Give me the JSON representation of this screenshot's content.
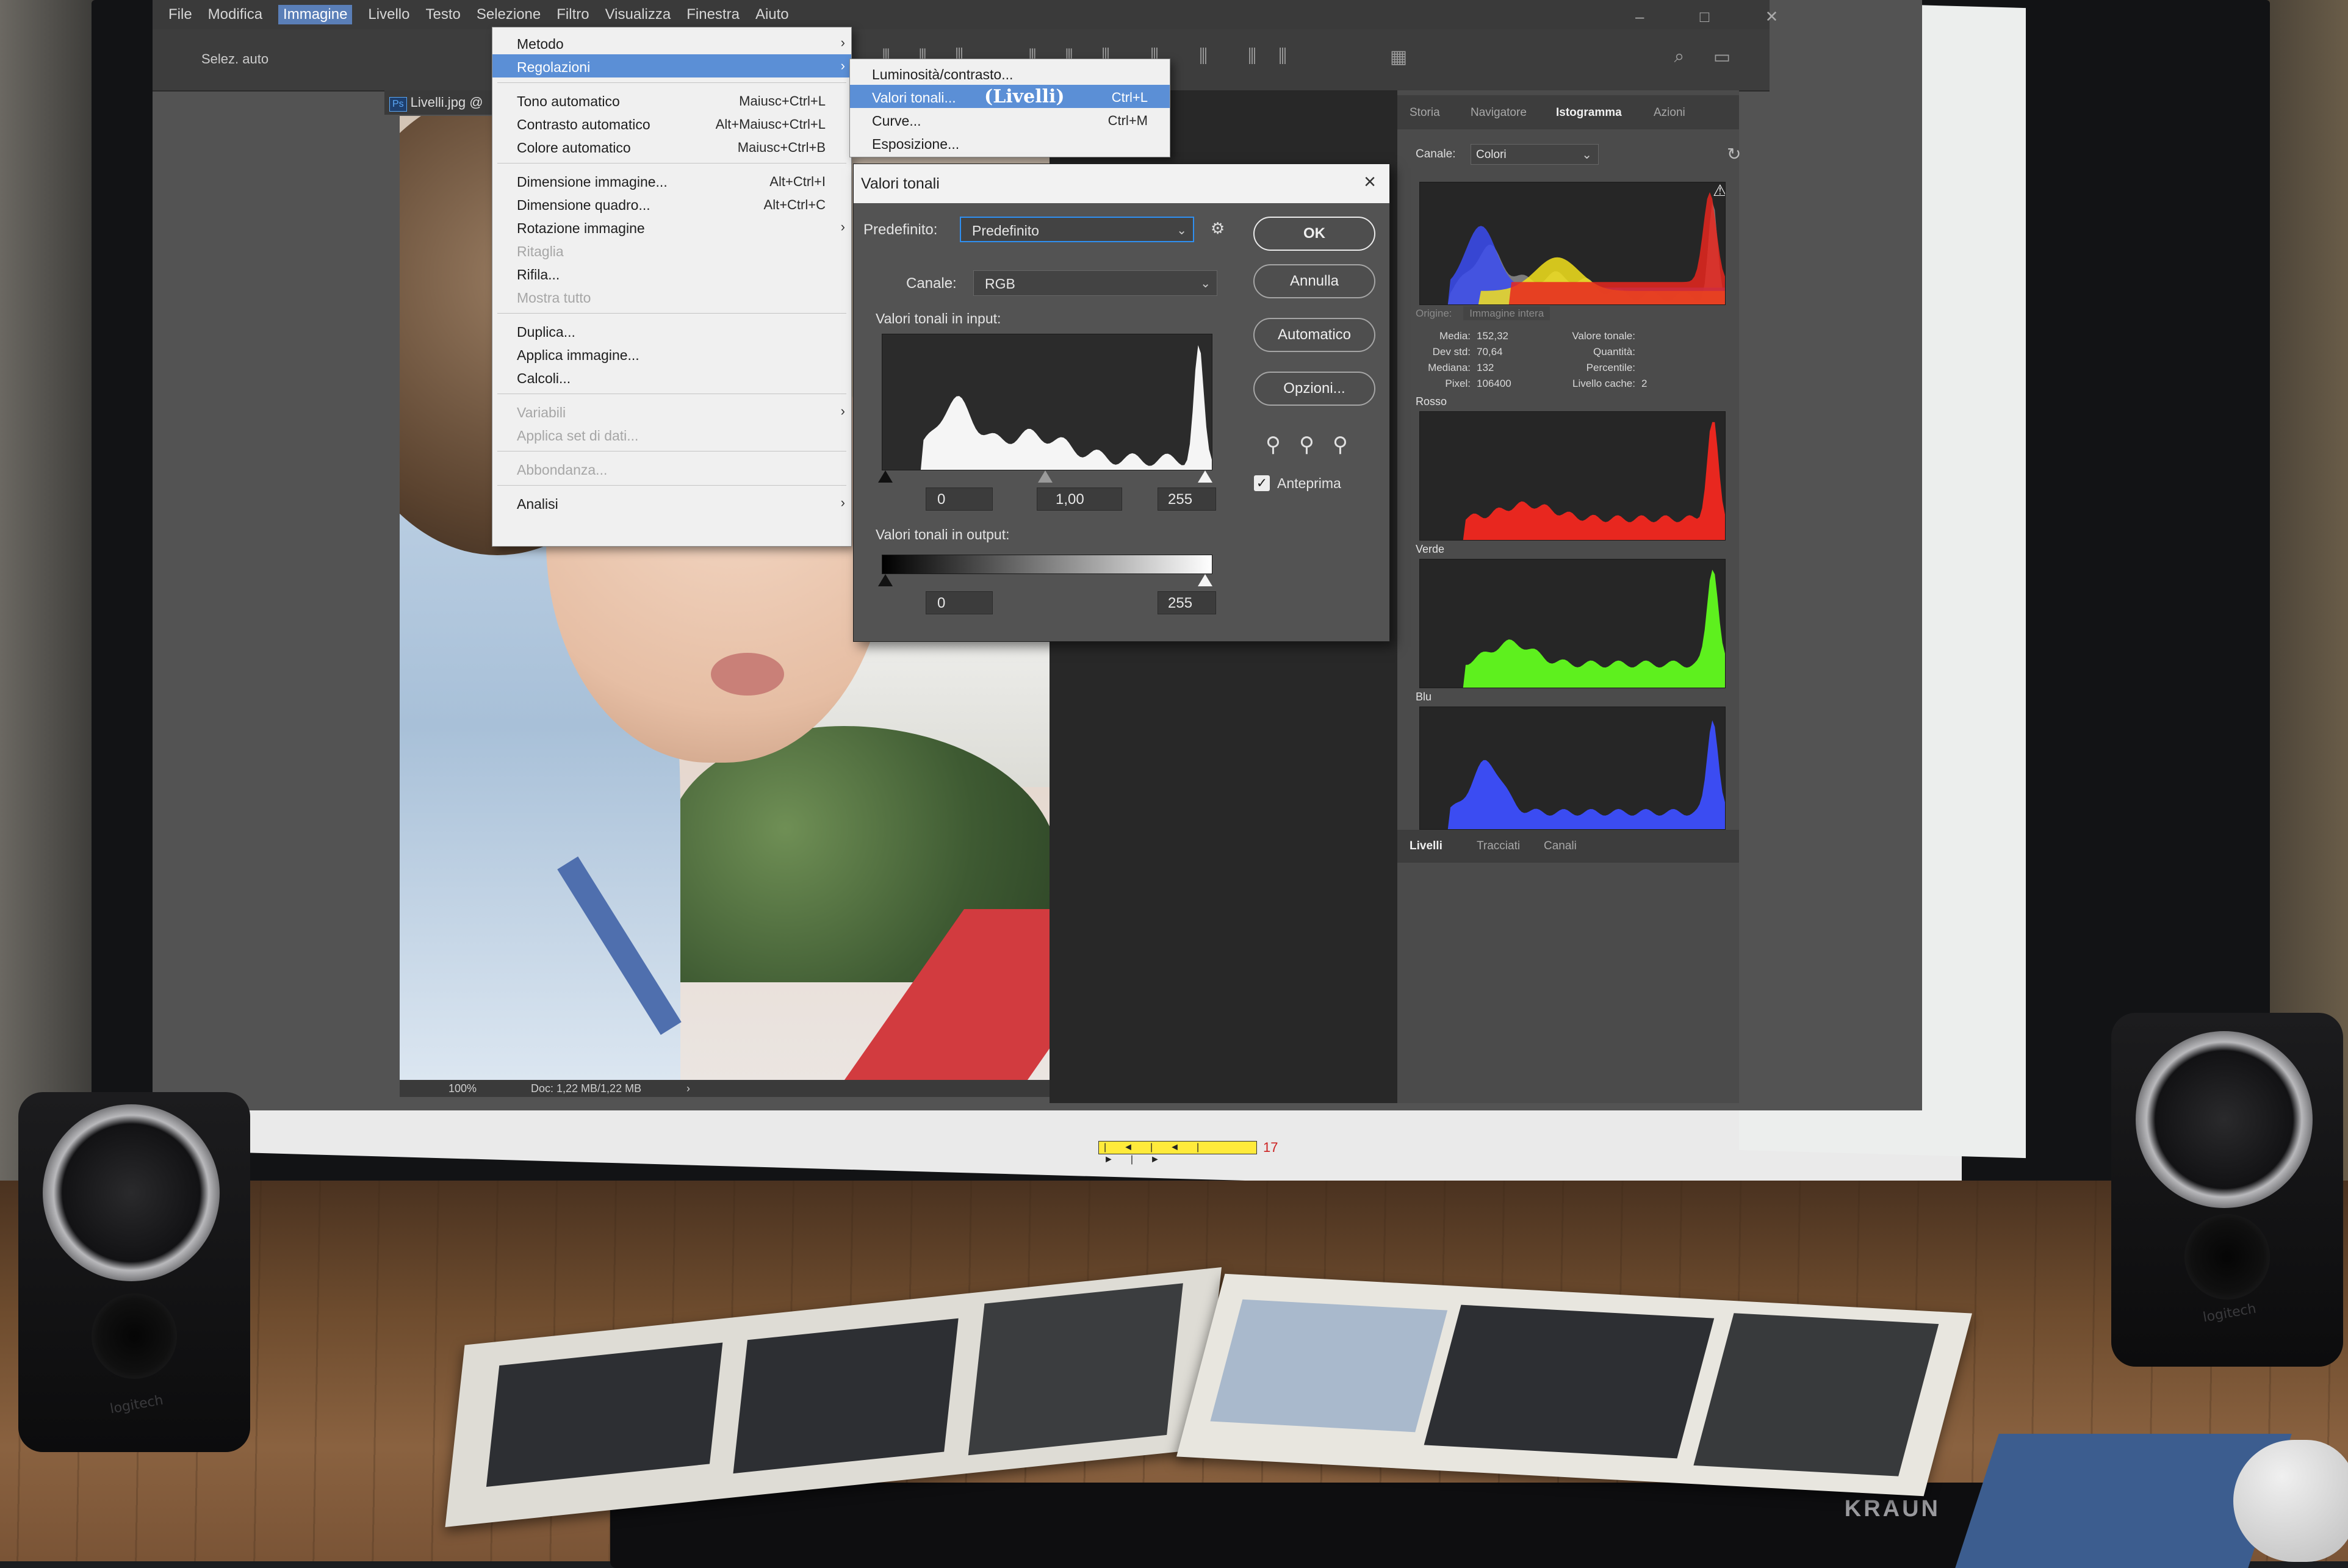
{
  "photoshop": {
    "menubar": [
      "File",
      "Modifica",
      "Immagine",
      "Livello",
      "Testo",
      "Selezione",
      "Filtro",
      "Visualizza",
      "Finestra",
      "Aiuto"
    ],
    "menubar_active_index": 2,
    "options_bar_text": "Selez. auto",
    "document_tab": "Livelli.jpg @",
    "document_badge": "Ps",
    "status_zoom": "100%",
    "status_doc": "Doc: 1,22 MB/1,22 MB"
  },
  "immagine_menu": {
    "items": [
      {
        "label": "Metodo",
        "shortcut": "",
        "arrow": true,
        "disabled": false
      },
      {
        "label": "Regolazioni",
        "shortcut": "",
        "arrow": true,
        "disabled": false,
        "highlighted": true
      },
      {
        "label": "Tono automatico",
        "shortcut": "Maiusc+Ctrl+L",
        "arrow": false,
        "disabled": false
      },
      {
        "label": "Contrasto automatico",
        "shortcut": "Alt+Maiusc+Ctrl+L",
        "arrow": false,
        "disabled": false
      },
      {
        "label": "Colore automatico",
        "shortcut": "Maiusc+Ctrl+B",
        "arrow": false,
        "disabled": false
      },
      {
        "label": "Dimensione immagine...",
        "shortcut": "Alt+Ctrl+I",
        "arrow": false,
        "disabled": false
      },
      {
        "label": "Dimensione quadro...",
        "shortcut": "Alt+Ctrl+C",
        "arrow": false,
        "disabled": false
      },
      {
        "label": "Rotazione immagine",
        "shortcut": "",
        "arrow": true,
        "disabled": false
      },
      {
        "label": "Ritaglia",
        "shortcut": "",
        "arrow": false,
        "disabled": true
      },
      {
        "label": "Rifila...",
        "shortcut": "",
        "arrow": false,
        "disabled": false
      },
      {
        "label": "Mostra tutto",
        "shortcut": "",
        "arrow": false,
        "disabled": true
      },
      {
        "label": "Duplica...",
        "shortcut": "",
        "arrow": false,
        "disabled": false
      },
      {
        "label": "Applica immagine...",
        "shortcut": "",
        "arrow": false,
        "disabled": false
      },
      {
        "label": "Calcoli...",
        "shortcut": "",
        "arrow": false,
        "disabled": false
      },
      {
        "label": "Variabili",
        "shortcut": "",
        "arrow": true,
        "disabled": true
      },
      {
        "label": "Applica set di dati...",
        "shortcut": "",
        "arrow": false,
        "disabled": true
      },
      {
        "label": "Abbondanza...",
        "shortcut": "",
        "arrow": false,
        "disabled": true
      },
      {
        "label": "Analisi",
        "shortcut": "",
        "arrow": true,
        "disabled": false
      }
    ]
  },
  "regolazioni_submenu": {
    "items": [
      {
        "label": "Luminosità/contrasto...",
        "shortcut": ""
      },
      {
        "label": "Valori tonali...",
        "shortcut": "Ctrl+L",
        "highlighted": true
      },
      {
        "label": "Curve...",
        "shortcut": "Ctrl+M"
      },
      {
        "label": "Esposizione...",
        "shortcut": ""
      }
    ],
    "handwritten_note": "(Livelli)"
  },
  "levels_dialog": {
    "title": "Valori tonali",
    "preset_label": "Predefinito:",
    "preset_value": "Predefinito",
    "channel_label": "Canale:",
    "channel_value": "RGB",
    "input_label": "Valori tonali in input:",
    "input_black": "0",
    "input_gamma": "1,00",
    "input_white": "255",
    "output_label": "Valori tonali in output:",
    "output_black": "0",
    "output_white": "255",
    "buttons": {
      "ok": "OK",
      "cancel": "Annulla",
      "auto": "Automatico",
      "options": "Opzioni..."
    },
    "preview_label": "Anteprima",
    "preview_checked": true
  },
  "histogram_panel": {
    "tabs": [
      "Storia",
      "Navigatore",
      "Istogramma",
      "Azioni"
    ],
    "active_tab": "Istogramma",
    "channel_label": "Canale:",
    "channel_value": "Colori",
    "source_label": "Origine:",
    "source_value": "Immagine intera",
    "stats_left": [
      {
        "k": "Media:",
        "v": "152,32"
      },
      {
        "k": "Dev std:",
        "v": "70,64"
      },
      {
        "k": "Mediana:",
        "v": "132"
      },
      {
        "k": "Pixel:",
        "v": "106400"
      }
    ],
    "stats_right": [
      {
        "k": "Valore tonale:",
        "v": ""
      },
      {
        "k": "Quantità:",
        "v": ""
      },
      {
        "k": "Percentile:",
        "v": ""
      },
      {
        "k": "Livello cache:",
        "v": "2"
      }
    ],
    "channels": [
      {
        "name": "Rosso",
        "color": "#e8271f"
      },
      {
        "name": "Verde",
        "color": "#5ef01e"
      },
      {
        "name": "Blu",
        "color": "#3b4cf2"
      }
    ],
    "bottom_tabs": [
      "Livelli",
      "Tracciati",
      "Canali"
    ]
  },
  "hardware": {
    "speaker_brand": "logitech",
    "keyboard_brand": "KRAUN",
    "ruler_number": "17"
  }
}
